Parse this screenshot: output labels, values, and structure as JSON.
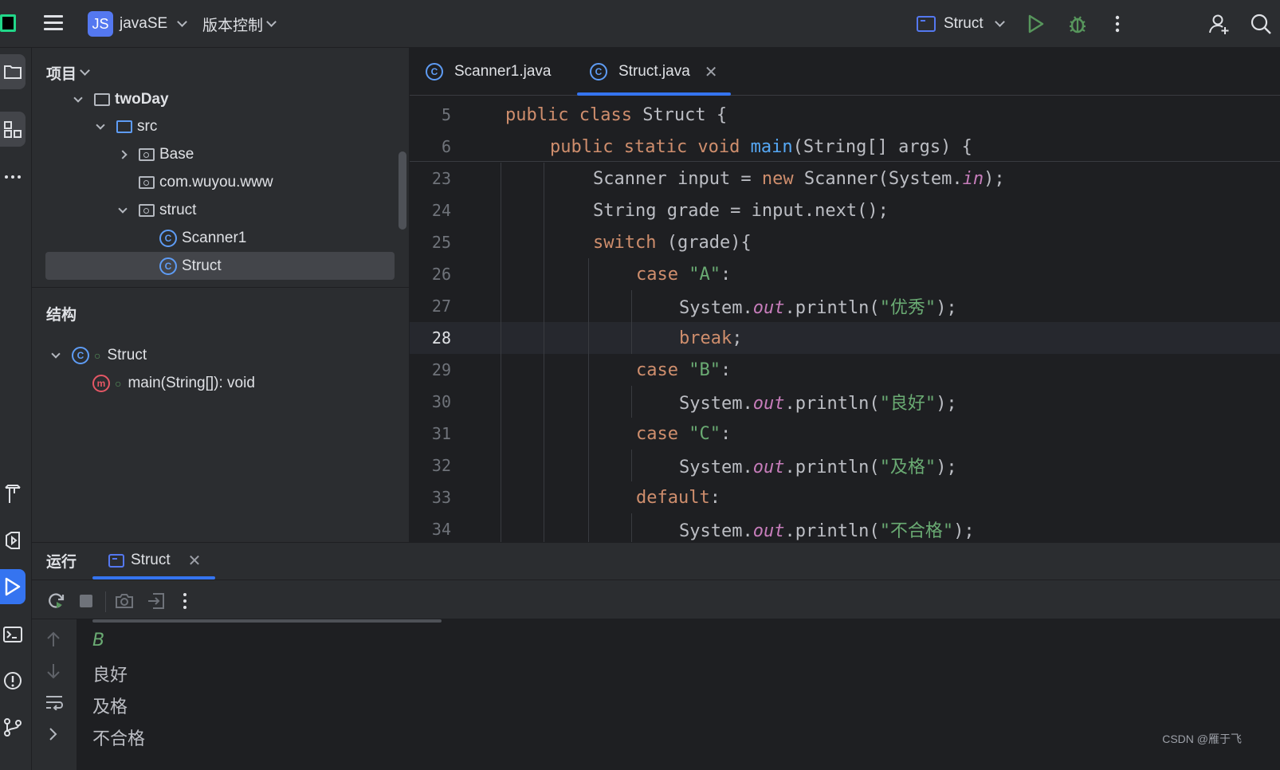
{
  "titlebar": {
    "project_badge": "JS",
    "project_name": "javaSE",
    "vcs_label": "版本控制",
    "run_config": "Struct"
  },
  "project_panel": {
    "title": "项目",
    "tree": [
      {
        "label": "twoDay"
      },
      {
        "label": "src"
      },
      {
        "label": "Base"
      },
      {
        "label": "com.wuyou.www"
      },
      {
        "label": "struct"
      },
      {
        "label": "Scanner1"
      },
      {
        "label": "Struct",
        "selected": true
      }
    ]
  },
  "structure_panel": {
    "title": "结构",
    "items": [
      {
        "label": "Struct"
      },
      {
        "label": "main(String[]): void"
      }
    ]
  },
  "editor": {
    "tabs": [
      {
        "label": "Scanner1.java",
        "active": false
      },
      {
        "label": "Struct.java",
        "active": true
      }
    ],
    "current_line": "28",
    "lines": [
      {
        "n": "5"
      },
      {
        "n": "6"
      },
      {
        "n": "23"
      },
      {
        "n": "24"
      },
      {
        "n": "25"
      },
      {
        "n": "26"
      },
      {
        "n": "27"
      },
      {
        "n": "28"
      },
      {
        "n": "29"
      },
      {
        "n": "30"
      },
      {
        "n": "31"
      },
      {
        "n": "32"
      },
      {
        "n": "33"
      },
      {
        "n": "34"
      }
    ],
    "strings": {
      "l5_kw": "public class ",
      "l5_rest": "Struct {",
      "l6_kw": "public static void ",
      "l6_fn": "main",
      "l6_rest": "(String[] args) {",
      "l23_a": "Scanner input = ",
      "l23_kw": "new",
      "l23_b": " Scanner(System.",
      "l23_it": "in",
      "l23_c": ");",
      "l24": "String grade = input.next();",
      "l25_kw": "switch",
      "l25_rest": " (grade){",
      "l26_kw": "case ",
      "l26_st": "\"A\"",
      "l26_rest": ":",
      "l27_a": "System.",
      "l27_it": "out",
      "l27_b": ".println(",
      "l27_st": "\"优秀\"",
      "l27_c": ");",
      "l28_kw": "break",
      "l28_rest": ";",
      "l29_kw": "case ",
      "l29_st": "\"B\"",
      "l29_rest": ":",
      "l30_a": "System.",
      "l30_it": "out",
      "l30_b": ".println(",
      "l30_st": "\"良好\"",
      "l30_c": ");",
      "l31_kw": "case ",
      "l31_st": "\"C\"",
      "l31_rest": ":",
      "l32_a": "System.",
      "l32_it": "out",
      "l32_b": ".println(",
      "l32_st": "\"及格\"",
      "l32_c": ");",
      "l33_kw": "default",
      "l33_rest": ":",
      "l34_a": "System.",
      "l34_it": "out",
      "l34_b": ".println(",
      "l34_st": "\"不合格\"",
      "l34_c": ");"
    }
  },
  "run_panel": {
    "title": "运行",
    "tab_label": "Struct",
    "console": [
      "B",
      "良好",
      "及格",
      "不合格"
    ]
  },
  "watermark": "CSDN @雁于飞",
  "colors": {
    "background": "#1e1f22",
    "panel": "#2b2d30",
    "accent": "#3574f0",
    "keyword": "#cf8e6d",
    "string": "#6aab73",
    "function": "#56a8f5",
    "static_field": "#c77dbb"
  }
}
